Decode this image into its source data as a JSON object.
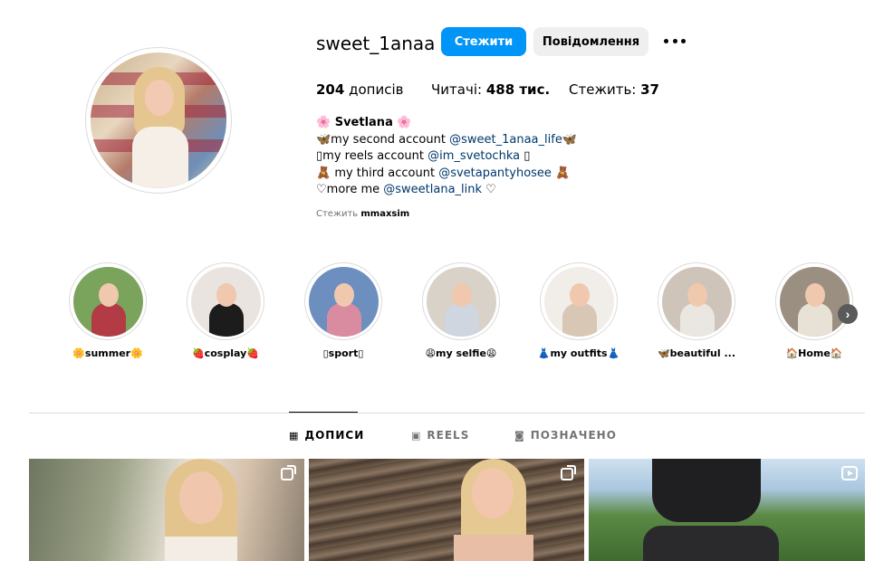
{
  "profile": {
    "username": "sweet_1anaa",
    "follow_label": "Стежити",
    "message_label": "Повідомлення",
    "stats": {
      "posts_count": "204",
      "posts_label": "дописів",
      "followers_label": "Читачі:",
      "followers_count": "488 тис.",
      "following_label": "Стежить:",
      "following_count": "37"
    },
    "bio": {
      "name": "🌸 Svetlana 🌸",
      "line1_pre": "🦋my second account ",
      "line1_link": "@sweet_1anaa_life",
      "line1_post": "🦋",
      "line2_pre": "▯my reels account ",
      "line2_link": "@im_svetochka",
      "line2_post": " ▯",
      "line3_pre": "🧸 my third account ",
      "line3_link": "@svetapantyhosee",
      "line3_post": " 🧸",
      "line4_pre": "♡more me ",
      "line4_link": "@sweetlana_link",
      "line4_post": " ♡"
    },
    "followed_by_label": "Стежить",
    "followed_by_user": "mmaxsim"
  },
  "highlights": [
    {
      "label": "🌼summer🌼",
      "bg": "#7aa35c",
      "fig": "#b23b45"
    },
    {
      "label": "🍓cosplay🍓",
      "bg": "#e9e4df",
      "fig": "#1c1c1c"
    },
    {
      "label": "▯sport▯",
      "bg": "#6c8fbf",
      "fig": "#d98ca0"
    },
    {
      "label": "😩my selfie😩",
      "bg": "#d8d2c8",
      "fig": "#cfd6e0"
    },
    {
      "label": "👗my outfits👗",
      "bg": "#f1eeea",
      "fig": "#d8c7b5"
    },
    {
      "label": "🦋beautiful ...",
      "bg": "#cfc4b9",
      "fig": "#eae6e1"
    },
    {
      "label": "🏠Home🏠",
      "bg": "#9a8f80",
      "fig": "#e7e1d6"
    }
  ],
  "tabs": [
    {
      "label": "ДОПИСИ",
      "icon": "grid-icon",
      "glyph": "▦"
    },
    {
      "label": "REELS",
      "icon": "reels-icon",
      "glyph": "▣"
    },
    {
      "label": "ПОЗНАЧЕНО",
      "icon": "tagged-icon",
      "glyph": "◙"
    }
  ],
  "colors": {
    "accent": "#0095f6",
    "link": "#00376b",
    "muted": "#737373",
    "divider": "#dbdbdb"
  }
}
